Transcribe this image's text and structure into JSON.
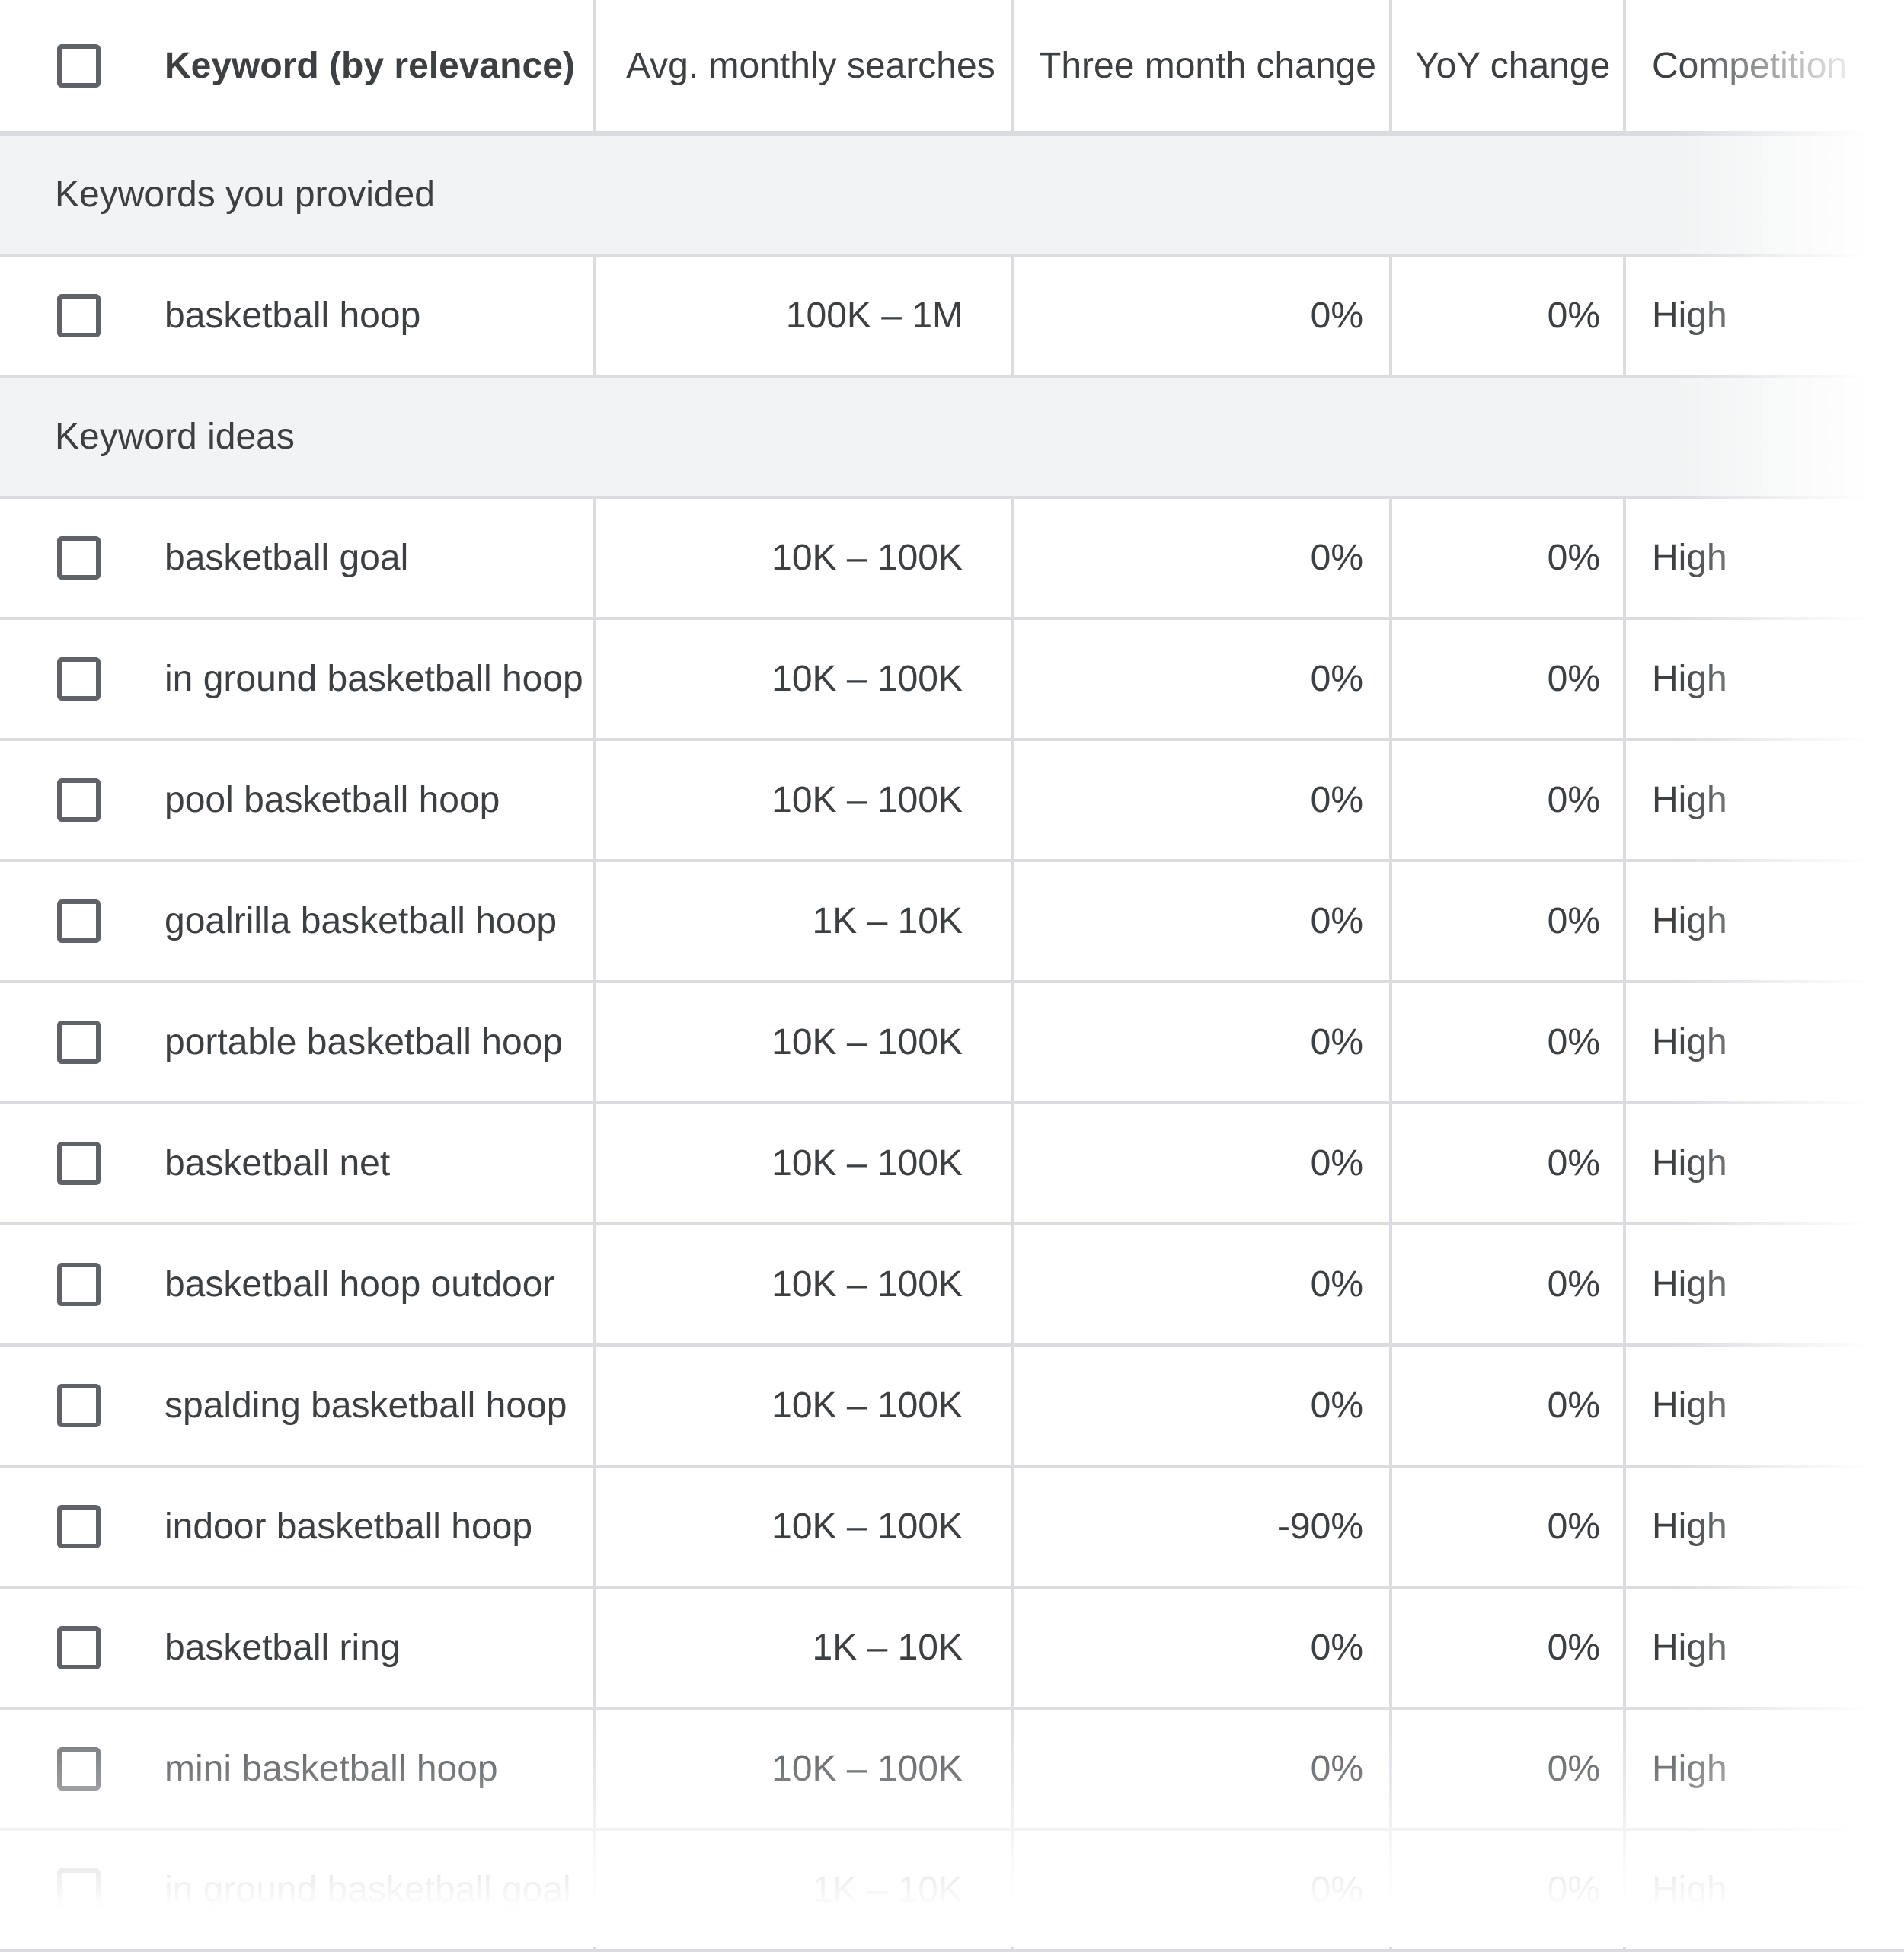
{
  "columns": {
    "keyword": "Keyword (by relevance)",
    "avg_monthly_searches": "Avg. monthly searches",
    "three_month_change": "Three month change",
    "yoy_change": "YoY change",
    "competition": "Competition"
  },
  "groups": [
    {
      "label": "Keywords you provided",
      "rows": [
        {
          "keyword": "basketball hoop",
          "avg": "100K – 1M",
          "three_month": "0%",
          "yoy": "0%",
          "competition": "High"
        }
      ]
    },
    {
      "label": "Keyword ideas",
      "rows": [
        {
          "keyword": "basketball goal",
          "avg": "10K – 100K",
          "three_month": "0%",
          "yoy": "0%",
          "competition": "High"
        },
        {
          "keyword": "in ground basketball hoop",
          "avg": "10K – 100K",
          "three_month": "0%",
          "yoy": "0%",
          "competition": "High"
        },
        {
          "keyword": "pool basketball hoop",
          "avg": "10K – 100K",
          "three_month": "0%",
          "yoy": "0%",
          "competition": "High"
        },
        {
          "keyword": "goalrilla basketball hoop",
          "avg": "1K – 10K",
          "three_month": "0%",
          "yoy": "0%",
          "competition": "High"
        },
        {
          "keyword": "portable basketball hoop",
          "avg": "10K – 100K",
          "three_month": "0%",
          "yoy": "0%",
          "competition": "High"
        },
        {
          "keyword": "basketball net",
          "avg": "10K – 100K",
          "three_month": "0%",
          "yoy": "0%",
          "competition": "High"
        },
        {
          "keyword": "basketball hoop outdoor",
          "avg": "10K – 100K",
          "three_month": "0%",
          "yoy": "0%",
          "competition": "High"
        },
        {
          "keyword": "spalding basketball hoop",
          "avg": "10K – 100K",
          "three_month": "0%",
          "yoy": "0%",
          "competition": "High"
        },
        {
          "keyword": "indoor basketball hoop",
          "avg": "10K – 100K",
          "three_month": "-90%",
          "yoy": "0%",
          "competition": "High"
        },
        {
          "keyword": "basketball ring",
          "avg": "1K – 10K",
          "three_month": "0%",
          "yoy": "0%",
          "competition": "High"
        },
        {
          "keyword": "mini basketball hoop",
          "avg": "10K – 100K",
          "three_month": "0%",
          "yoy": "0%",
          "competition": "High"
        },
        {
          "keyword": "in ground basketball goal",
          "avg": "1K – 10K",
          "three_month": "0%",
          "yoy": "0%",
          "competition": "High"
        }
      ]
    }
  ],
  "colors": {
    "text": "#3c4043",
    "border": "#dadce0",
    "group_bg": "#f1f3f4",
    "checkbox_border": "#5f6368"
  }
}
